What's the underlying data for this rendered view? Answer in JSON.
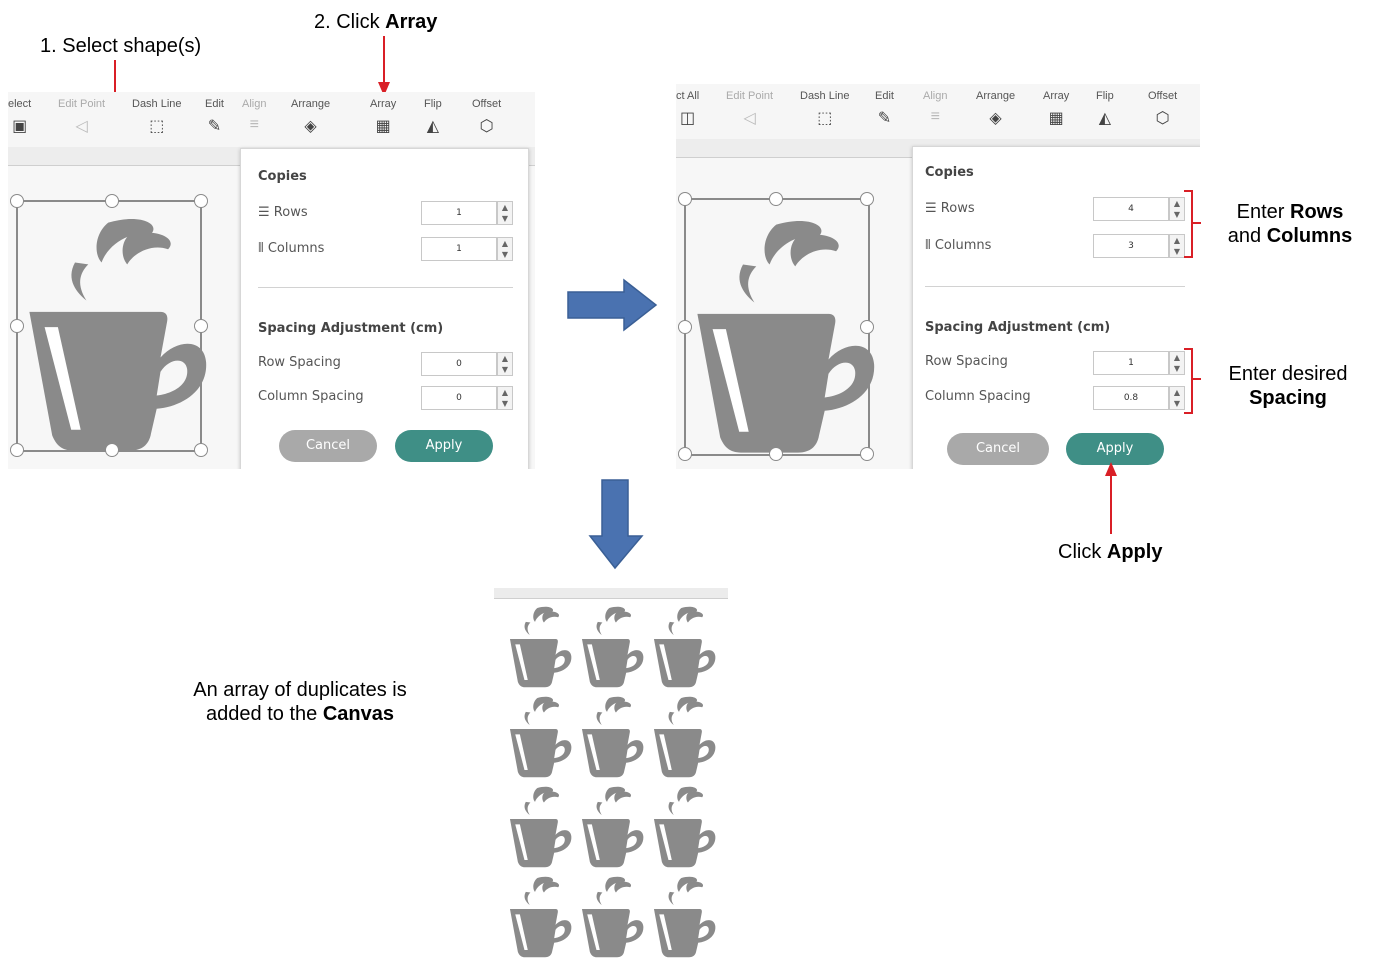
{
  "callouts": {
    "step1": "1.  Select shape(s)",
    "step2_prefix": "2.  Click ",
    "step2_bold": "Array",
    "rows_line1_prefix": "Enter ",
    "rows_line1_bold": "Rows",
    "rows_line2_prefix": "and ",
    "rows_line2_bold": "Columns",
    "spacing_line1": "Enter desired",
    "spacing_line2_bold": "Spacing",
    "apply_prefix": "Click ",
    "apply_bold": "Apply",
    "result_line1": "An array of duplicates is",
    "result_line2_prefix": "added to the ",
    "result_line2_bold": "Canvas"
  },
  "left_panel": {
    "toolbar": [
      "elect",
      "Edit Point",
      "Dash Line",
      "Edit",
      "Align",
      "Arrange",
      "Array",
      "Flip",
      "Offset"
    ],
    "dialog": {
      "copies_heading": "Copies",
      "rows_label": "Rows",
      "rows_value": "1",
      "columns_label": "Columns",
      "columns_value": "1",
      "spacing_heading": "Spacing Adjustment (cm)",
      "row_spacing_label": "Row Spacing",
      "row_spacing_value": "0",
      "column_spacing_label": "Column Spacing",
      "column_spacing_value": "0",
      "cancel_label": "Cancel",
      "apply_label": "Apply"
    }
  },
  "right_panel": {
    "toolbar": [
      "ct All",
      "Edit Point",
      "Dash Line",
      "Edit",
      "Align",
      "Arrange",
      "Array",
      "Flip",
      "Offset"
    ],
    "dialog": {
      "copies_heading": "Copies",
      "rows_label": "Rows",
      "rows_value": "4",
      "columns_label": "Columns",
      "columns_value": "3",
      "spacing_heading": "Spacing Adjustment (cm)",
      "row_spacing_label": "Row Spacing",
      "row_spacing_value": "1",
      "column_spacing_label": "Column Spacing",
      "column_spacing_value": "0.8",
      "cancel_label": "Cancel",
      "apply_label": "Apply"
    }
  },
  "result_grid": {
    "rows": 4,
    "columns": 3
  },
  "colors": {
    "accent_apply": "#3f8f86",
    "cancel_gray": "#a9a9a9",
    "callout_red": "#d91f26",
    "flow_arrow_blue": "#4a72b0",
    "cup_gray": "#8a8a8a"
  }
}
